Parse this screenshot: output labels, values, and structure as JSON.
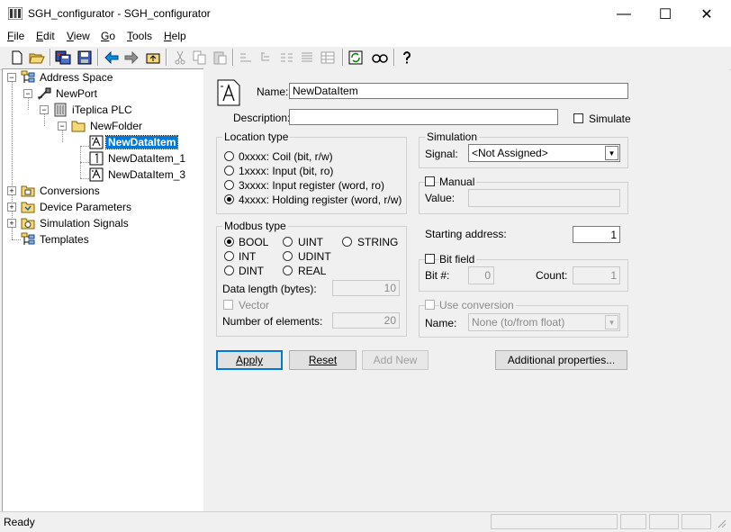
{
  "window": {
    "title": "SGH_configurator - SGH_configurator",
    "minimize": "—",
    "maximize": "☐",
    "close": "✕"
  },
  "menu": [
    {
      "underline": "F",
      "rest": "ile"
    },
    {
      "underline": "E",
      "rest": "dit"
    },
    {
      "underline": "V",
      "rest": "iew"
    },
    {
      "underline": "G",
      "rest": "o"
    },
    {
      "underline": "T",
      "rest": "ools"
    },
    {
      "underline": "H",
      "rest": "elp"
    }
  ],
  "toolbar_icons": [
    "new-icon",
    "open-icon",
    "save-all-icon",
    "save-icon",
    "back-icon",
    "forward-icon",
    "up-folder-icon",
    "cut-icon",
    "copy-icon",
    "paste-icon",
    "align-icon",
    "tree-icon",
    "list-icon",
    "details-icon",
    "grid-icon",
    "refresh-icon",
    "find-icon",
    "help-icon"
  ],
  "tree": {
    "address_space": "Address Space",
    "new_port": "NewPort",
    "plc": "iTeplica PLC",
    "folder": "NewFolder",
    "item_selected": "NewDataItem",
    "item_1": "NewDataItem_1",
    "item_3": "NewDataItem_3",
    "conversions": "Conversions",
    "device_parameters": "Device Parameters",
    "simulation_signals": "Simulation Signals",
    "templates": "Templates"
  },
  "form": {
    "name_label": "Name:",
    "name_value": "NewDataItem",
    "description_label": "Description:",
    "description_value": "",
    "simulate_label": "Simulate",
    "location_type": {
      "title": "Location type",
      "options": [
        {
          "label": "0xxxx: Coil (bit, r/w)",
          "selected": false
        },
        {
          "label": "1xxxx: Input (bit, ro)",
          "selected": false
        },
        {
          "label": "3xxxx: Input register (word, ro)",
          "selected": false
        },
        {
          "label": "4xxxx: Holding register (word, r/w)",
          "selected": true
        }
      ]
    },
    "simulation": {
      "title": "Simulation",
      "signal_label": "Signal:",
      "signal_value": "<Not Assigned>"
    },
    "manual": {
      "title": "Manual",
      "value_label": "Value:",
      "value": ""
    },
    "modbus_type": {
      "title": "Modbus type",
      "bool": "BOOL",
      "uint": "UINT",
      "string": "STRING",
      "int": "INT",
      "udint": "UDINT",
      "dint": "DINT",
      "real": "REAL",
      "data_length_label": "Data length (bytes):",
      "data_length": "10",
      "vector_label": "Vector",
      "elements_label": "Number of elements:",
      "elements": "20"
    },
    "starting_address_label": "Starting address:",
    "starting_address": "1",
    "bit_field": {
      "title": "Bit field",
      "bit_label": "Bit #:",
      "bit_value": "0",
      "count_label": "Count:",
      "count_value": "1"
    },
    "use_conversion": {
      "title": "Use conversion",
      "name_label": "Name:",
      "name_value": "None (to/from float)"
    },
    "buttons": {
      "apply": "Apply",
      "reset": "Reset",
      "add_new": "Add New",
      "additional": "Additional properties..."
    }
  },
  "status": {
    "text": "Ready"
  }
}
